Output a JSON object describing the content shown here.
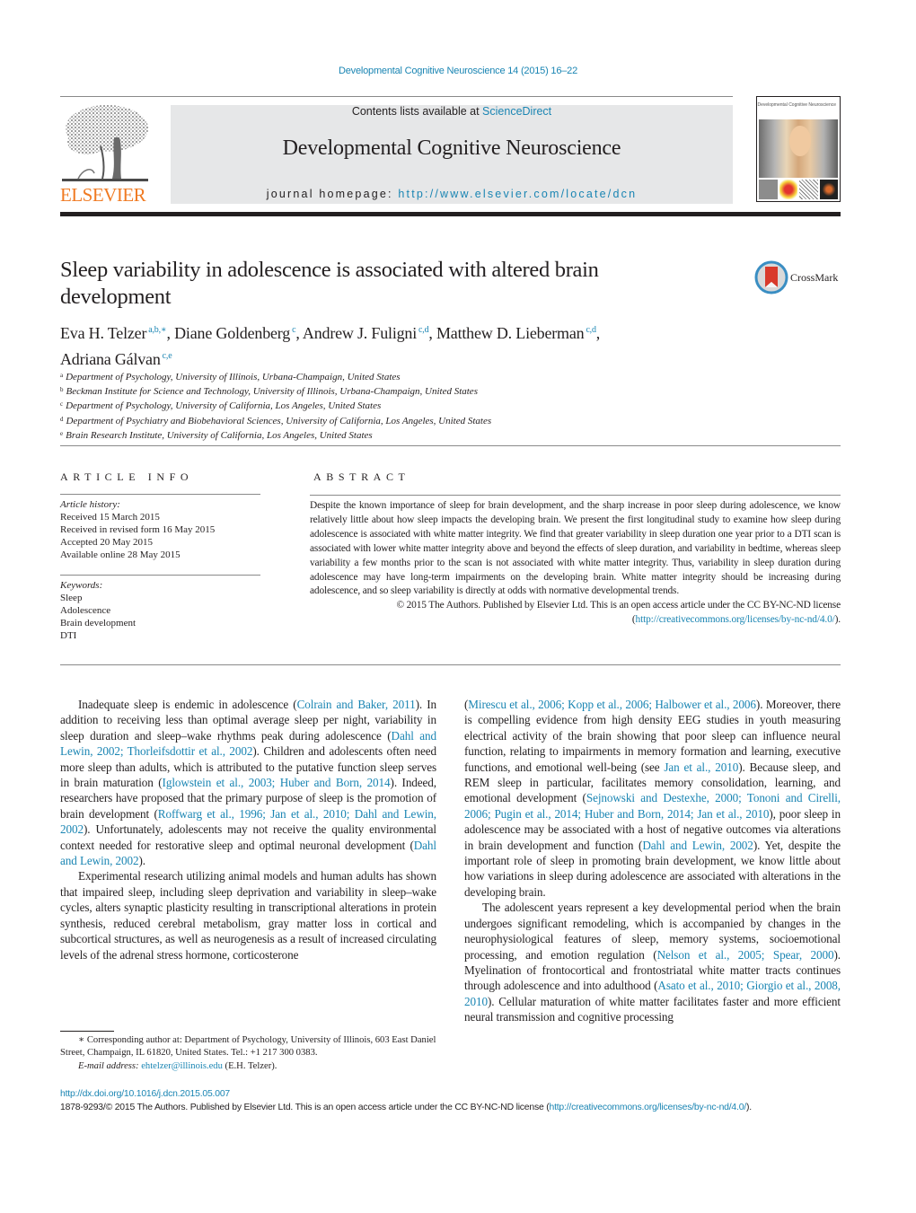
{
  "journal": {
    "running_head": "Developmental Cognitive Neuroscience 14 (2015) 16–22",
    "contents_prefix": "Contents lists available at ",
    "contents_link": "ScienceDirect",
    "title": "Developmental Cognitive Neuroscience",
    "homepage_prefix": "journal homepage: ",
    "homepage_url": "http://www.elsevier.com/locate/dcn",
    "publisher_logo": "ELSEVIER",
    "cover_title": "Developmental Cognitive Neuroscience"
  },
  "colors": {
    "link": "#1a85b3",
    "elsevier_orange": "#f07a22",
    "masthead_bg": "#e6e7e8",
    "text": "#231f20"
  },
  "article": {
    "title": "Sleep variability in adolescence is associated with altered brain development",
    "crossmark_label": "CrossMark",
    "authors": [
      {
        "name": "Eva H. Telzer",
        "sup": "a,b,∗",
        "sep": ", "
      },
      {
        "name": "Diane Goldenberg",
        "sup": "c",
        "sep": ", "
      },
      {
        "name": "Andrew J. Fuligni",
        "sup": "c,d",
        "sep": ", "
      },
      {
        "name": "Matthew D. Lieberman",
        "sup": "c,d",
        "sep": ","
      },
      {
        "name": "Adriana Gálvan",
        "sup": "c,e",
        "sep": ""
      }
    ],
    "affiliations": [
      {
        "key": "a",
        "text": "Department of Psychology, University of Illinois, Urbana-Champaign, United States"
      },
      {
        "key": "b",
        "text": "Beckman Institute for Science and Technology, University of Illinois, Urbana-Champaign, United States"
      },
      {
        "key": "c",
        "text": "Department of Psychology, University of California, Los Angeles, United States"
      },
      {
        "key": "d",
        "text": "Department of Psychiatry and Biobehavioral Sciences, University of California, Los Angeles, United States"
      },
      {
        "key": "e",
        "text": "Brain Research Institute, University of California, Los Angeles, United States"
      }
    ]
  },
  "article_info": {
    "heading": "ARTICLE INFO",
    "history_label": "Article history:",
    "history": [
      "Received 15 March 2015",
      "Received in revised form 16 May 2015",
      "Accepted 20 May 2015",
      "Available online 28 May 2015"
    ],
    "keywords_label": "Keywords:",
    "keywords": [
      "Sleep",
      "Adolescence",
      "Brain development",
      "DTI"
    ]
  },
  "abstract": {
    "heading": "ABSTRACT",
    "text": "Despite the known importance of sleep for brain development, and the sharp increase in poor sleep during adolescence, we know relatively little about how sleep impacts the developing brain. We present the first longitudinal study to examine how sleep during adolescence is associated with white matter integrity. We find that greater variability in sleep duration one year prior to a DTI scan is associated with lower white matter integrity above and beyond the effects of sleep duration, and variability in bedtime, whereas sleep variability a few months prior to the scan is not associated with white matter integrity. Thus, variability in sleep duration during adolescence may have long-term impairments on the developing brain. White matter integrity should be increasing during adolescence, and so sleep variability is directly at odds with normative developmental trends.",
    "copyright": "© 2015 The Authors. Published by Elsevier Ltd. This is an open access article under the CC BY-NC-ND license (",
    "license_url": "http://creativecommons.org/licenses/by-nc-nd/4.0/",
    "copyright_end": ")."
  },
  "body": {
    "left_column": [
      {
        "cont": false,
        "segments": [
          {
            "t": "Inadequate sleep is endemic in adolescence ("
          },
          {
            "t": "Colrain and Baker, 2011",
            "link": true
          },
          {
            "t": "). In addition to receiving less than optimal average sleep per night, variability in sleep duration and sleep–wake rhythms peak during adolescence ("
          },
          {
            "t": "Dahl and Lewin, 2002; Thorleifsdottir et al., 2002",
            "link": true
          },
          {
            "t": "). Children and adolescents often need more sleep than adults, which is attributed to the putative function sleep serves in brain maturation ("
          },
          {
            "t": "Iglowstein et al., 2003; Huber and Born, 2014",
            "link": true
          },
          {
            "t": "). Indeed, researchers have proposed that the primary purpose of sleep is the promotion of brain development ("
          },
          {
            "t": "Roffwarg et al., 1996; Jan et al., 2010; Dahl and Lewin, 2002",
            "link": true
          },
          {
            "t": "). Unfortunately, adolescents may not receive the quality environmental context needed for restorative sleep and optimal neuronal development ("
          },
          {
            "t": "Dahl and Lewin, 2002",
            "link": true
          },
          {
            "t": ")."
          }
        ]
      },
      {
        "cont": false,
        "segments": [
          {
            "t": "Experimental research utilizing animal models and human adults has shown that impaired sleep, including sleep deprivation and variability in sleep–wake cycles, alters synaptic plasticity resulting in transcriptional alterations in protein synthesis, reduced cerebral metabolism, gray matter loss in cortical and subcortical structures, as well as neurogenesis as a result of increased circulating levels of the adrenal stress hormone, corticosterone"
          }
        ]
      }
    ],
    "right_column": [
      {
        "cont": true,
        "segments": [
          {
            "t": "("
          },
          {
            "t": "Mirescu et al., 2006; Kopp et al., 2006; Halbower et al., 2006",
            "link": true
          },
          {
            "t": "). Moreover, there is compelling evidence from high density EEG studies in youth measuring electrical activity of the brain showing that poor sleep can influence neural function, relating to impairments in memory formation and learning, executive functions, and emotional well-being (see "
          },
          {
            "t": "Jan et al., 2010",
            "link": true
          },
          {
            "t": "). Because sleep, and REM sleep in particular, facilitates memory consolidation, learning, and emotional development ("
          },
          {
            "t": "Sejnowski and Destexhe, 2000; Tononi and Cirelli, 2006; Pugin et al., 2014; Huber and Born, 2014; Jan et al., 2010",
            "link": true
          },
          {
            "t": "), poor sleep in adolescence may be associated with a host of negative outcomes via alterations in brain development and function ("
          },
          {
            "t": "Dahl and Lewin, 2002",
            "link": true
          },
          {
            "t": "). Yet, despite the important role of sleep in promoting brain development, we know little about how variations in sleep during adolescence are associated with alterations in the developing brain."
          }
        ]
      },
      {
        "cont": false,
        "segments": [
          {
            "t": "The adolescent years represent a key developmental period when the brain undergoes significant remodeling, which is accompanied by changes in the neurophysiological features of sleep, memory systems, socioemotional processing, and emotion regulation ("
          },
          {
            "t": "Nelson et al., 2005; Spear, 2000",
            "link": true
          },
          {
            "t": "). Myelination of frontocortical and frontostriatal white matter tracts continues through adolescence and into adulthood ("
          },
          {
            "t": "Asato et al., 2010; Giorgio et al., 2008, 2010",
            "link": true
          },
          {
            "t": "). Cellular maturation of white matter facilitates faster and more efficient neural transmission and cognitive processing"
          }
        ]
      }
    ]
  },
  "footnote": {
    "corresponding": "∗ Corresponding author at: Department of Psychology, University of Illinois, 603 East Daniel Street, Champaign, IL 61820, United States. Tel.: +1 217 300 0383.",
    "email_label": "E-mail address: ",
    "email": "ehtelzer@illinois.edu",
    "email_suffix": " (E.H. Telzer)."
  },
  "doi": {
    "url": "http://dx.doi.org/10.1016/j.dcn.2015.05.007",
    "license_prefix": "1878-9293/© 2015 The Authors. Published by Elsevier Ltd. This is an open access article under the CC BY-NC-ND license (",
    "license_url": "http://creativecommons.org/licenses/by-nc-nd/4.0/",
    "license_suffix": ")."
  }
}
